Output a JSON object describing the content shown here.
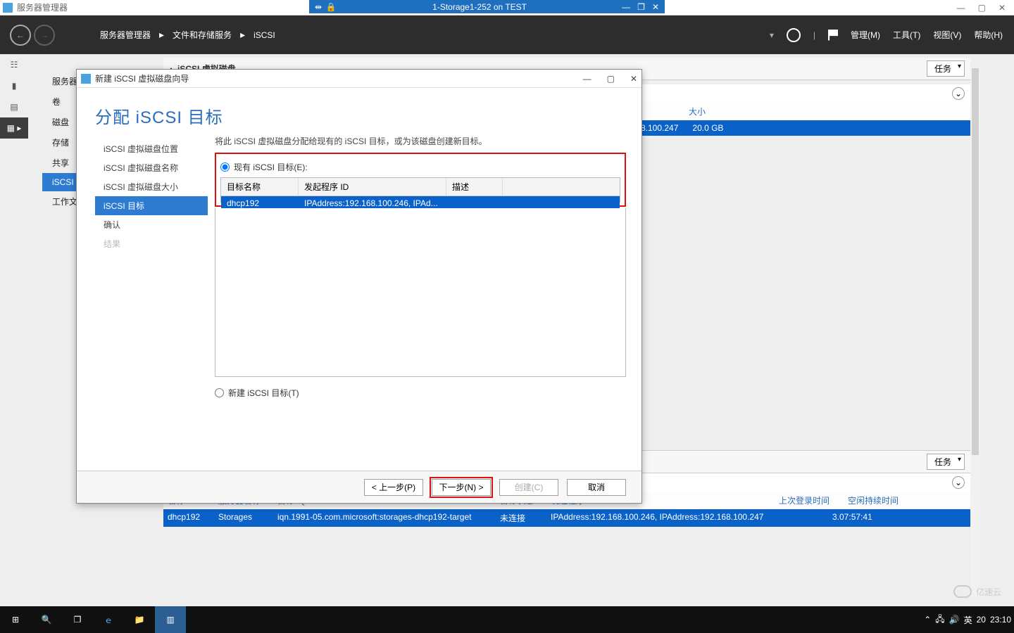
{
  "outer": {
    "appTitle": "服务器管理器"
  },
  "vm": {
    "title": "1-Storage1-252 on TEST"
  },
  "header": {
    "breadcrumb1": "服务器管理器",
    "breadcrumb2": "文件和存储服务",
    "breadcrumb3": "iSCSI",
    "menu": {
      "manage": "管理(M)",
      "tools": "工具(T)",
      "view": "视图(V)",
      "help": "帮助(H)"
    }
  },
  "sidebar": {
    "items": [
      "服务器",
      "卷",
      "磁盘",
      "存储",
      "共享",
      "iSCSI",
      "工作文"
    ]
  },
  "topSection": {
    "title": "iSCSI 虚拟磁盘",
    "tasks": "任务",
    "sizecol": "大小",
    "rowip": "8.100.247",
    "rowsize": "20.0 GB"
  },
  "wizard": {
    "title": "新建 iSCSI 虚拟磁盘向导",
    "heading": "分配 iSCSI 目标",
    "steps": [
      "iSCSI 虚拟磁盘位置",
      "iSCSI 虚拟磁盘名称",
      "iSCSI 虚拟磁盘大小",
      "iSCSI 目标",
      "确认",
      "结果"
    ],
    "instr": "将此 iSCSI 虚拟磁盘分配给现有的 iSCSI 目标，或为该磁盘创建新目标。",
    "radio1": "现有 iSCSI 目标(E):",
    "radio2": "新建 iSCSI 目标(T)",
    "cols": {
      "name": "目标名称",
      "initiator": "发起程序 ID",
      "desc": "描述"
    },
    "row": {
      "name": "dhcp192",
      "initiator": "IPAddress:192.168.100.246, IPAd..."
    },
    "buttons": {
      "prev": "< 上一步(P)",
      "next": "下一步(N) >",
      "create": "创建(C)",
      "cancel": "取消"
    }
  },
  "targetsPanel": {
    "tasks": "任务",
    "cols": {
      "name": "名称",
      "server": "服务器名称",
      "iqn": "目标 IQN",
      "status": "目标状态",
      "initiator": "发起程序 ID",
      "last": "上次登录时间",
      "idle": "空闲持续时间"
    },
    "row": {
      "name": "dhcp192",
      "server": "Storages",
      "iqn": "iqn.1991-05.com.microsoft:storages-dhcp192-target",
      "status": "未连接",
      "initiator": "IPAddress:192.168.100.246, IPAddress:192.168.100.247",
      "last": "",
      "idle": "3.07:57:41"
    }
  },
  "tray": {
    "ime": "英",
    "num": "20",
    "time": "23:10"
  },
  "watermark": "亿速云"
}
